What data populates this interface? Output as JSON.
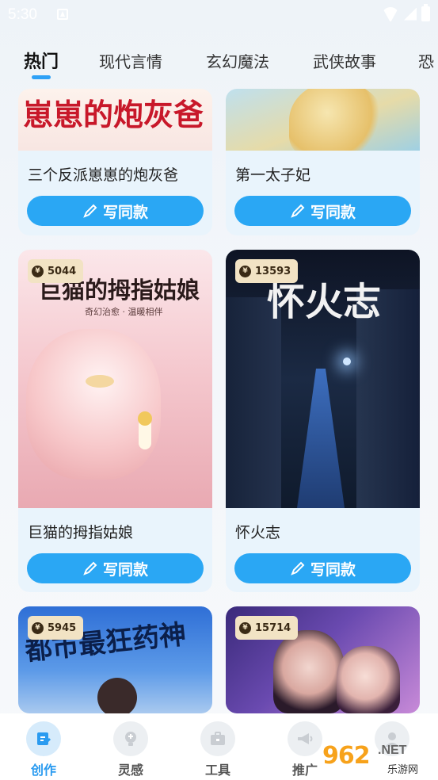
{
  "status_bar": {
    "time": "5:30"
  },
  "tabs": [
    {
      "label": "热门",
      "active": true
    },
    {
      "label": "现代言情"
    },
    {
      "label": "玄幻魔法"
    },
    {
      "label": "武侠故事"
    },
    {
      "label": "恐"
    }
  ],
  "cards": [
    {
      "title": "三个反派崽崽的炮灰爸",
      "cover_text": "崽崽的炮灰爸",
      "button": "写同款"
    },
    {
      "title": "第一太子妃",
      "cover_text": "",
      "button": "写同款"
    },
    {
      "title": "巨猫的拇指姑娘",
      "cover_text": "巨猫的拇指姑娘",
      "cover_subtext": "奇幻治愈 · 温暖相伴",
      "count": "5044",
      "button": "写同款"
    },
    {
      "title": "怀火志",
      "cover_text": "怀火志",
      "count": "13593",
      "button": "写同款"
    },
    {
      "title": "",
      "cover_text": "都市最狂药神",
      "count": "5945"
    },
    {
      "title": "",
      "cover_text": "",
      "count": "15714"
    }
  ],
  "bottom_nav": [
    {
      "label": "创作",
      "icon": "edit-icon",
      "active": true
    },
    {
      "label": "灵感",
      "icon": "bulb-icon"
    },
    {
      "label": "工具",
      "icon": "toolbox-icon"
    },
    {
      "label": "推广",
      "icon": "megaphone-icon"
    }
  ],
  "watermark": {
    "num": "962",
    "net": ".NET",
    "sub": "乐游网"
  },
  "colors": {
    "accent": "#2aa7f4",
    "card_bg": "#e9f4fc",
    "badge_bg": "#f2e3c4"
  }
}
